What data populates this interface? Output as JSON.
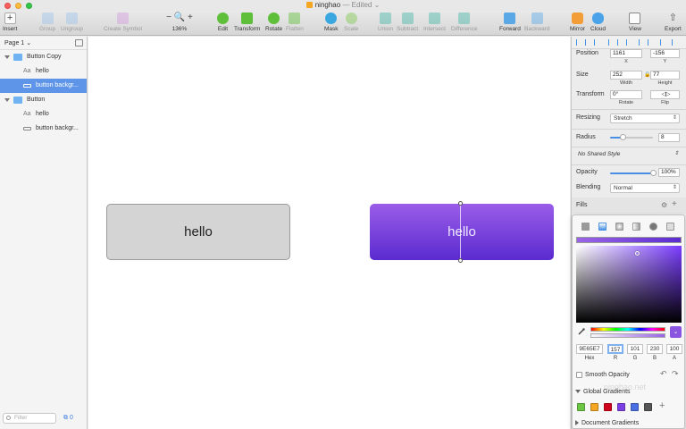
{
  "window": {
    "title": "ninghao",
    "status": "— Edited"
  },
  "toolbar": {
    "insert": "Insert",
    "group": "Group",
    "ungroup": "Ungroup",
    "create_symbol": "Create Symbol",
    "zoom": "136%",
    "edit": "Edit",
    "transform": "Transform",
    "rotate": "Rotate",
    "flatten": "Flatten",
    "mask": "Mask",
    "scale": "Scale",
    "union": "Union",
    "subtract": "Subtract",
    "intersect": "Intersect",
    "difference": "Difference",
    "forward": "Forward",
    "backward": "Backward",
    "mirror": "Mirror",
    "cloud": "Cloud",
    "view": "View",
    "export": "Export"
  },
  "layers": {
    "page": "Page 1",
    "items": [
      {
        "label": "Button Copy"
      },
      {
        "label": "hello",
        "kind": "Aa"
      },
      {
        "label": "button backgr..."
      },
      {
        "label": "Button"
      },
      {
        "label": "hello",
        "kind": "Aa"
      },
      {
        "label": "button backgr..."
      }
    ],
    "filter_placeholder": "Filter",
    "bottom_count": "0"
  },
  "canvas": {
    "gray_button_text": "hello",
    "purple_button_text": "hello"
  },
  "inspector": {
    "position_label": "Position",
    "pos_x": "1161",
    "pos_y": "-156",
    "x_label": "X",
    "y_label": "Y",
    "size_label": "Size",
    "width": "252",
    "height": "77",
    "width_label": "Width",
    "height_label": "Height",
    "transform_label": "Transform",
    "rotate_value": "0°",
    "rotate_label": "Rotate",
    "flip_label": "Flip",
    "resizing_label": "Resizing",
    "resizing_value": "Stretch",
    "radius_label": "Radius",
    "radius_value": "8",
    "radius_fraction": 0.3,
    "shared_style": "No Shared Style",
    "opacity_label": "Opacity",
    "opacity_value": "100%",
    "opacity_fraction": 1.0,
    "blending_label": "Blending",
    "blending_value": "Normal",
    "fills_label": "Fills"
  },
  "color_picker": {
    "hex": "9E65E7",
    "r": "157",
    "g": "101",
    "b": "230",
    "a": "100",
    "hex_label": "Hex",
    "r_label": "R",
    "g_label": "G",
    "b_label": "B",
    "a_label": "A",
    "smooth_opacity": "Smooth Opacity",
    "global_gradients": "Global Gradients",
    "document_gradients": "Document Gradients",
    "watermark": "ninghao.net",
    "swatch_colors": [
      "#6cc644",
      "#f5a623",
      "#d0021b",
      "#7b3fe4",
      "#4a6fe2",
      "#555555"
    ]
  },
  "colors": {
    "accent": "#4a90e2",
    "selection": "#5e95e8",
    "purple_top": "#9a5de8",
    "purple_bottom": "#5b2bd0"
  }
}
